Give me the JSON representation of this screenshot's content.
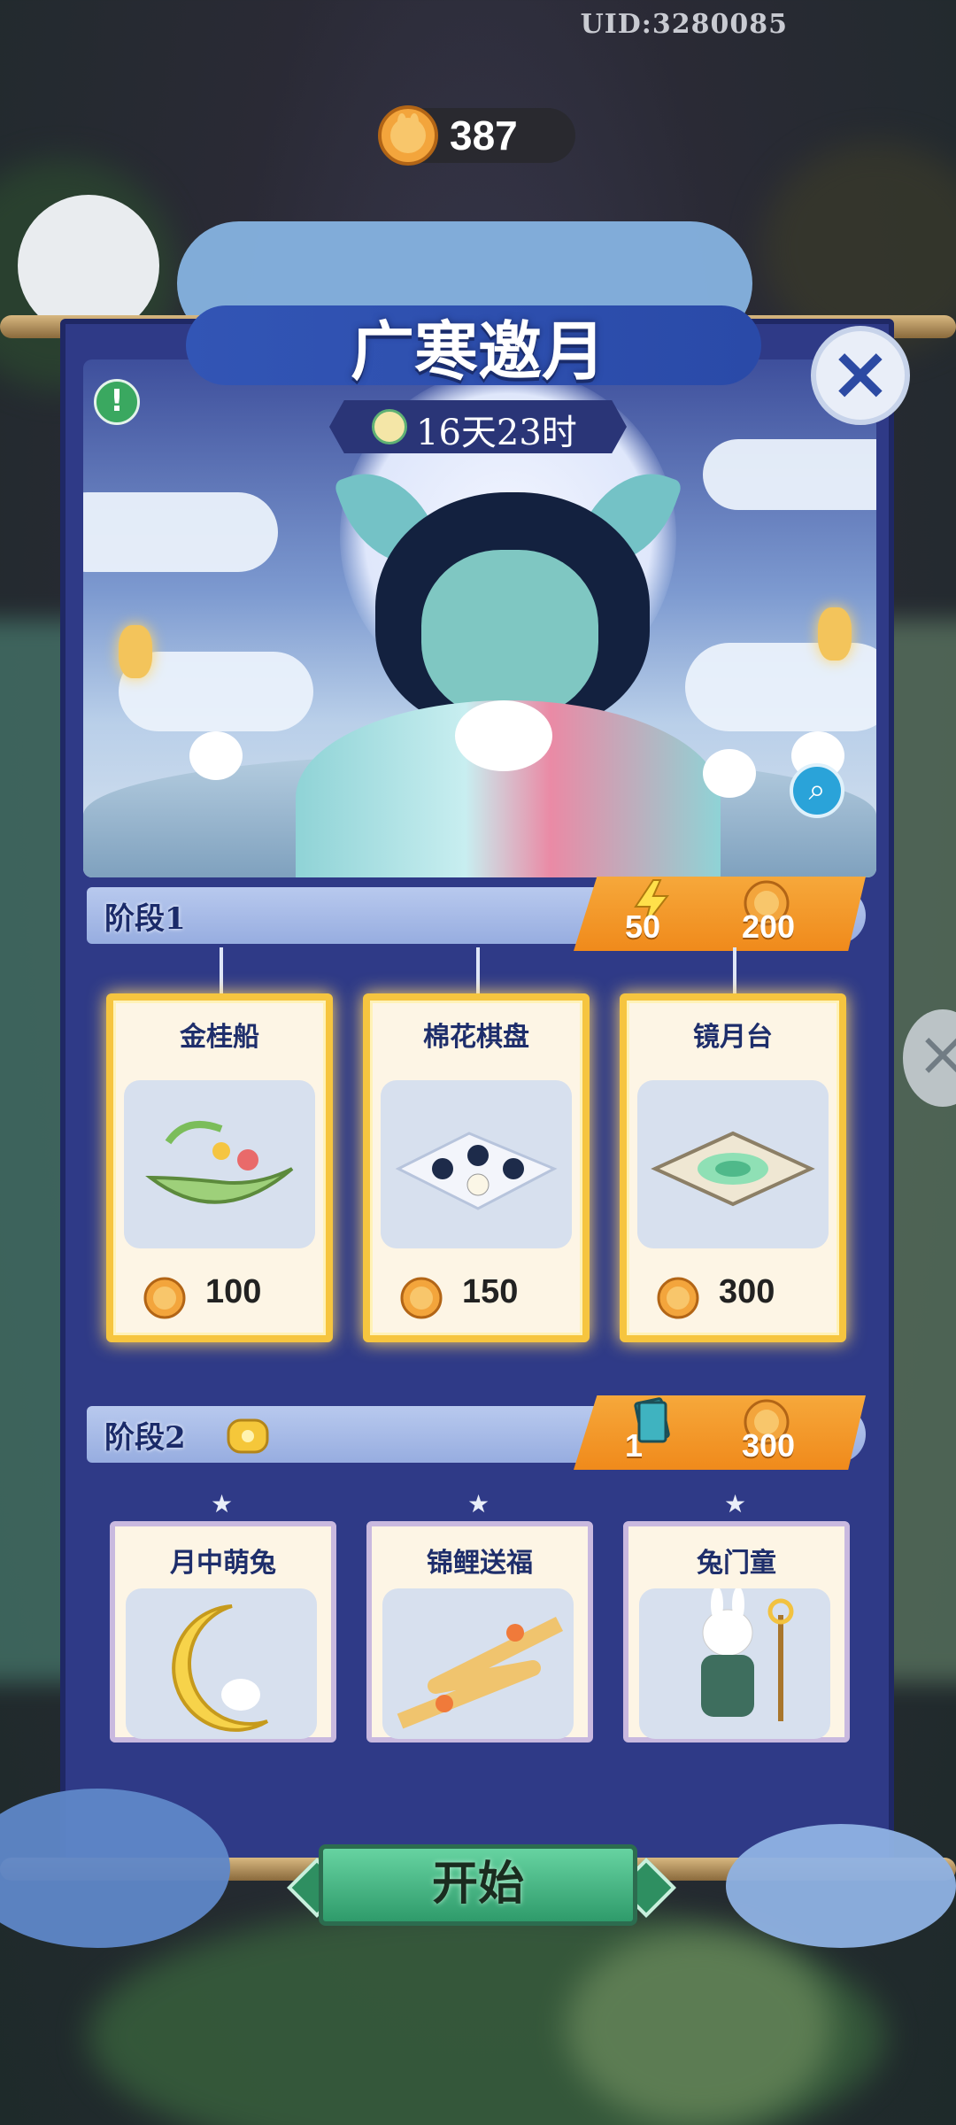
{
  "uid": "UID:3280085",
  "currency": {
    "icon": "mooncake-coin-icon",
    "value": "387"
  },
  "event": {
    "title": "广寒邀月",
    "timer": "16天23时",
    "timer_icon": "clock-icon"
  },
  "buttons": {
    "close": "×",
    "info": "!",
    "zoom": "search-icon",
    "start": "开始"
  },
  "stages": [
    {
      "label": "阶段1",
      "rewards": [
        {
          "icon": "lightning-icon",
          "value": "50"
        },
        {
          "icon": "mooncake-coin-icon",
          "value": "200"
        }
      ],
      "items": [
        {
          "name": "金桂船",
          "price": "100"
        },
        {
          "name": "棉花棋盘",
          "price": "150"
        },
        {
          "name": "镜月台",
          "price": "300"
        }
      ]
    },
    {
      "label": "阶段2",
      "lock_icon": "treasure-pouch-icon",
      "rewards": [
        {
          "icon": "card-pack-icon",
          "value": "1"
        },
        {
          "icon": "mooncake-coin-icon",
          "value": "300"
        }
      ],
      "items": [
        {
          "name": "月中萌兔"
        },
        {
          "name": "锦鲤送福"
        },
        {
          "name": "兔门童"
        }
      ]
    }
  ],
  "colors": {
    "panel": "#2f3a87",
    "accent_orange": "#f08a1b",
    "gold": "#f6c53f",
    "start_green": "#3aa873"
  }
}
